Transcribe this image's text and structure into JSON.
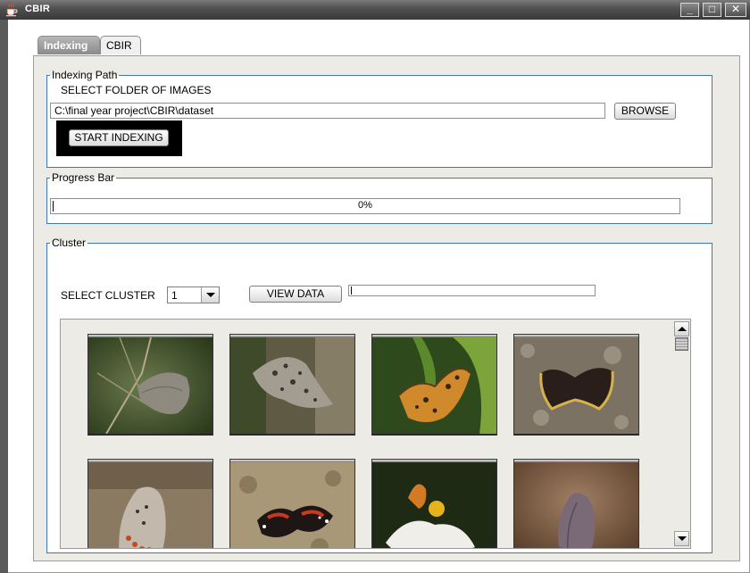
{
  "window": {
    "title": "CBIR",
    "app_icon": "java-coffee-cup-icon",
    "controls": {
      "minimize": "_",
      "maximize": "□",
      "close": "✕"
    }
  },
  "tabs": [
    {
      "label": "Indexing",
      "selected": true
    },
    {
      "label": "CBIR",
      "selected": false
    }
  ],
  "indexing": {
    "legend": "Indexing Path",
    "select_label": "SELECT FOLDER OF IMAGES",
    "path_value": "C:\\final year project\\CBIR\\dataset",
    "browse_label": "BROWSE",
    "start_label": "START INDEXING"
  },
  "progress": {
    "legend": "Progress Bar",
    "value": 0,
    "text": "0%"
  },
  "cluster": {
    "legend": "Cluster",
    "select_label": "SELECT CLUSTER",
    "selected_value": "1",
    "view_label": "VIEW DATA",
    "field_value": "",
    "thumbnails": [
      {
        "subject": "grey-butterfly-on-twig"
      },
      {
        "subject": "spotted-moth-on-bark"
      },
      {
        "subject": "comma-butterfly-on-leaf"
      },
      {
        "subject": "dark-butterfly-on-ground"
      },
      {
        "subject": "blue-butterfly-closed-wings"
      },
      {
        "subject": "red-admiral-butterfly"
      },
      {
        "subject": "orange-butterfly-on-white-flower"
      },
      {
        "subject": "brown-butterfly-on-soil"
      }
    ]
  },
  "colors": {
    "group_border": "#3e7ab0",
    "titlebar": "#4e4e4e",
    "panel_bg": "#ecebe6"
  }
}
